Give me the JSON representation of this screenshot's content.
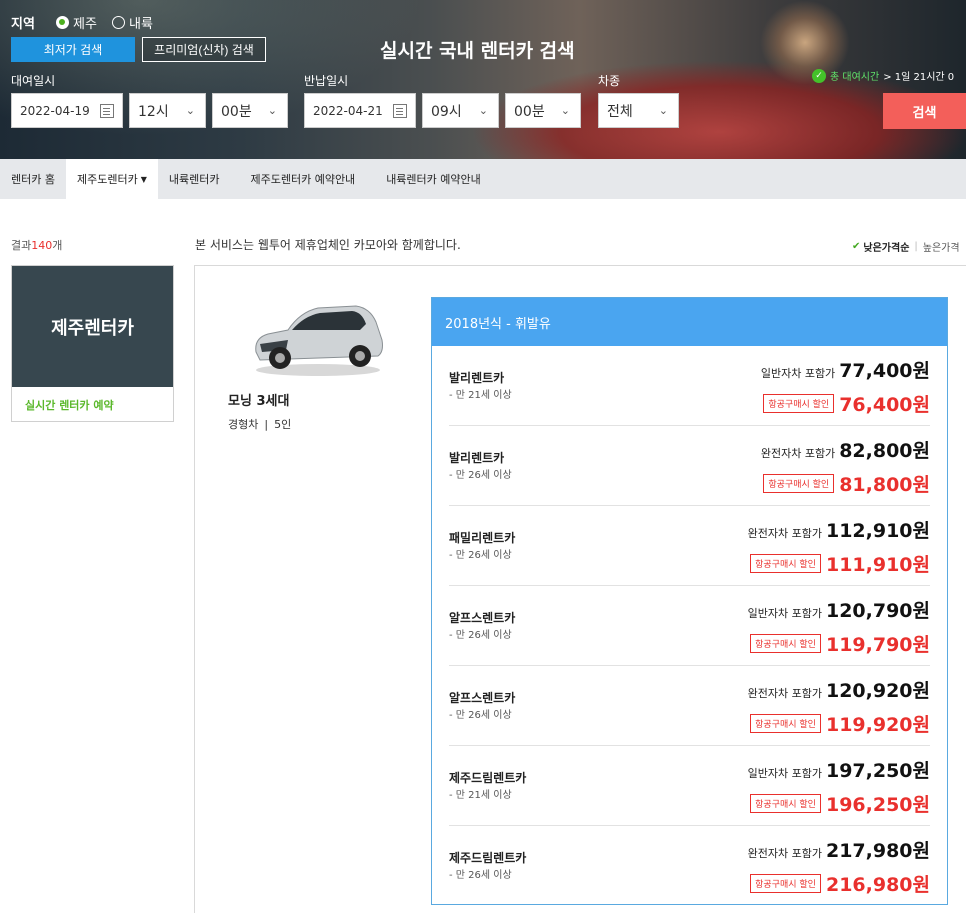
{
  "search": {
    "region_label": "지역",
    "region_options": [
      "제주",
      "내륙"
    ],
    "lowest_button": "최저가 검색",
    "premium_button": "프리미엄(신차) 검색",
    "title": "실시간 국내 렌터카 검색",
    "rent_label": "대여일시",
    "return_label": "반납일시",
    "car_type_label": "차종",
    "rent_date": "2022-04-19",
    "rent_hour": "12시",
    "rent_min": "00분",
    "return_date": "2022-04-21",
    "return_hour": "09시",
    "return_min": "00분",
    "car_type": "전체",
    "total_label": "총 대여시간",
    "total_value": "> 1일 21시간 0",
    "search_button": "검색"
  },
  "nav": [
    {
      "label": "렌터카 홈"
    },
    {
      "label": "제주도렌터카"
    },
    {
      "label": "내륙렌터카"
    },
    {
      "label": "제주도렌터카 예약안내"
    },
    {
      "label": "내륙렌터카 예약안내"
    }
  ],
  "result": {
    "prefix": "결과",
    "count": "140",
    "suffix": "개"
  },
  "notice": "본 서비스는 웹투어 제휴업체인 카모아와 함께합니다.",
  "sort": {
    "active": "낮은가격순",
    "inactive": "높은가격"
  },
  "brand": {
    "name": "제주렌터카",
    "link": "실시간 렌터카 예약"
  },
  "car": {
    "name": "모닝 3세대",
    "class": "경형차",
    "seats": "5인"
  },
  "offers_header": "2018년식 - 휘발유",
  "offers": [
    {
      "company": "발리렌트카",
      "age": "- 만 21세 이상",
      "insurance": "일반자차 포함가",
      "price": "77,400원",
      "badge": "항공구매시 할인",
      "discount": "76,400원"
    },
    {
      "company": "발리렌트카",
      "age": "- 만 26세 이상",
      "insurance": "완전자차 포함가",
      "price": "82,800원",
      "badge": "항공구매시 할인",
      "discount": "81,800원"
    },
    {
      "company": "패밀리렌트카",
      "age": "- 만 26세 이상",
      "insurance": "완전자차 포함가",
      "price": "112,910원",
      "badge": "항공구매시 할인",
      "discount": "111,910원"
    },
    {
      "company": "알프스렌트카",
      "age": "- 만 26세 이상",
      "insurance": "일반자차 포함가",
      "price": "120,790원",
      "badge": "항공구매시 할인",
      "discount": "119,790원"
    },
    {
      "company": "알프스렌트카",
      "age": "- 만 26세 이상",
      "insurance": "완전자차 포함가",
      "price": "120,920원",
      "badge": "항공구매시 할인",
      "discount": "119,920원"
    },
    {
      "company": "제주드림렌트카",
      "age": "- 만 21세 이상",
      "insurance": "일반자차 포함가",
      "price": "197,250원",
      "badge": "항공구매시 할인",
      "discount": "196,250원"
    },
    {
      "company": "제주드림렌트카",
      "age": "- 만 26세 이상",
      "insurance": "완전자차 포함가",
      "price": "217,980원",
      "badge": "항공구매시 할인",
      "discount": "216,980원"
    }
  ],
  "colors": {
    "accent_blue": "#1f93dd",
    "search_red": "#f35f5a",
    "discount_red": "#e9302d",
    "header_blue": "#4aa5f0",
    "brand_dark": "#37474f",
    "green": "#5ab82b"
  }
}
